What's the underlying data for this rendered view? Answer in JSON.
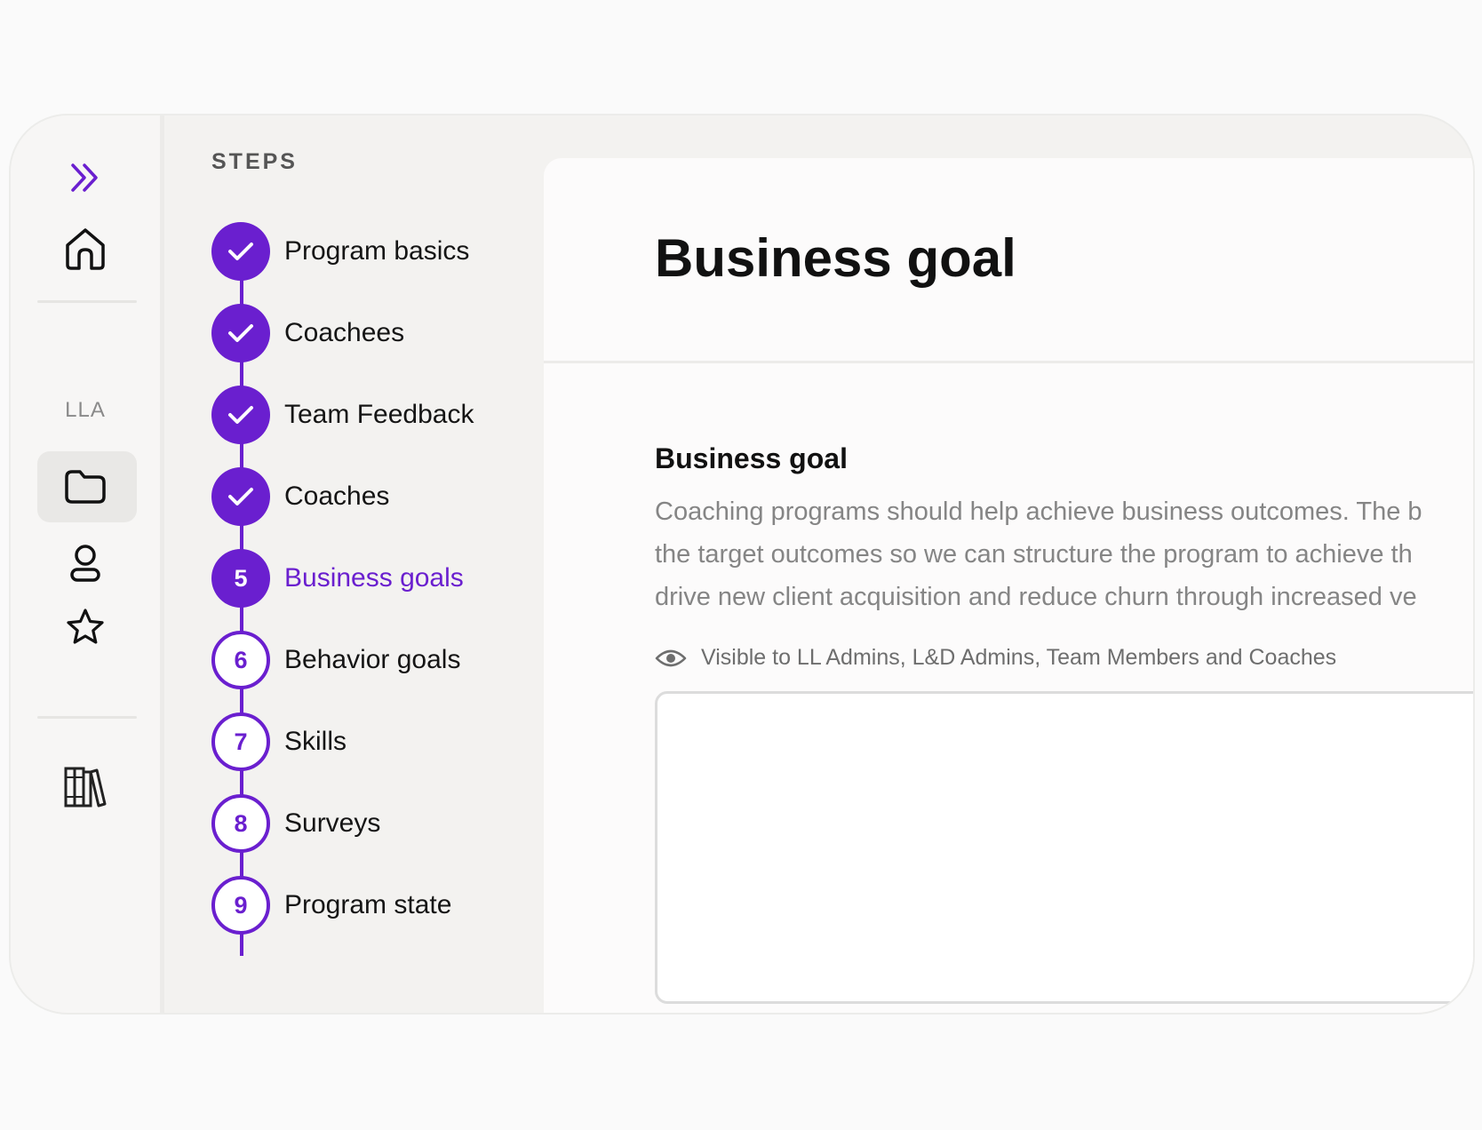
{
  "rail": {
    "section_label": "LLA",
    "icons": [
      "double-chevron-right-icon",
      "home-icon",
      "folder-icon",
      "user-icon",
      "star-icon",
      "library-icon"
    ]
  },
  "steps": {
    "heading": "STEPS",
    "items": [
      {
        "label": "Program basics",
        "state": "done",
        "marker": ""
      },
      {
        "label": "Coachees",
        "state": "done",
        "marker": ""
      },
      {
        "label": "Team Feedback",
        "state": "done",
        "marker": ""
      },
      {
        "label": "Coaches",
        "state": "done",
        "marker": ""
      },
      {
        "label": "Business goals",
        "state": "current",
        "marker": "5"
      },
      {
        "label": "Behavior goals",
        "state": "todo",
        "marker": "6"
      },
      {
        "label": "Skills",
        "state": "todo",
        "marker": "7"
      },
      {
        "label": "Surveys",
        "state": "todo",
        "marker": "8"
      },
      {
        "label": "Program state",
        "state": "todo",
        "marker": "9"
      }
    ]
  },
  "main": {
    "title": "Business goal",
    "section": {
      "heading": "Business goal",
      "description_lines": [
        "Coaching programs should help achieve business outcomes. The b",
        "the target outcomes so we can structure the program to achieve th",
        "drive new client acquisition and reduce churn through increased ve"
      ],
      "visibility_text": "Visible to LL Admins, L&D Admins, Team Members and Coaches",
      "input_value": "",
      "input_placeholder": ""
    }
  },
  "colors": {
    "accent": "#6a1fcf",
    "frame_background": "#f3f2f0",
    "panel_background": "#fcfbfb",
    "muted_text": "#858585"
  }
}
